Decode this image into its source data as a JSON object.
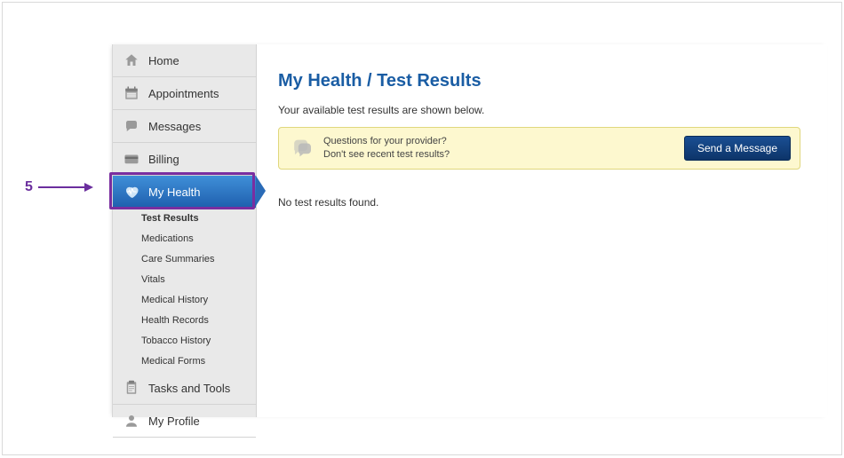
{
  "annotation": {
    "step": "5"
  },
  "sidebar": {
    "items": [
      {
        "label": "Home"
      },
      {
        "label": "Appointments"
      },
      {
        "label": "Messages"
      },
      {
        "label": "Billing"
      },
      {
        "label": "My Health"
      },
      {
        "label": "Tasks and Tools"
      },
      {
        "label": "My Profile"
      }
    ],
    "myhealth_sub": [
      {
        "label": "Test Results",
        "selected": true
      },
      {
        "label": "Medications"
      },
      {
        "label": "Care Summaries"
      },
      {
        "label": "Vitals"
      },
      {
        "label": "Medical History"
      },
      {
        "label": "Health Records"
      },
      {
        "label": "Tobacco History"
      },
      {
        "label": "Medical Forms"
      }
    ]
  },
  "main": {
    "title": "My Health / Test Results",
    "lead": "Your available test results are shown below.",
    "notice_line1": "Questions for your provider?",
    "notice_line2": "Don't see recent test results?",
    "send_button": "Send a Message",
    "empty": "No test results found."
  }
}
